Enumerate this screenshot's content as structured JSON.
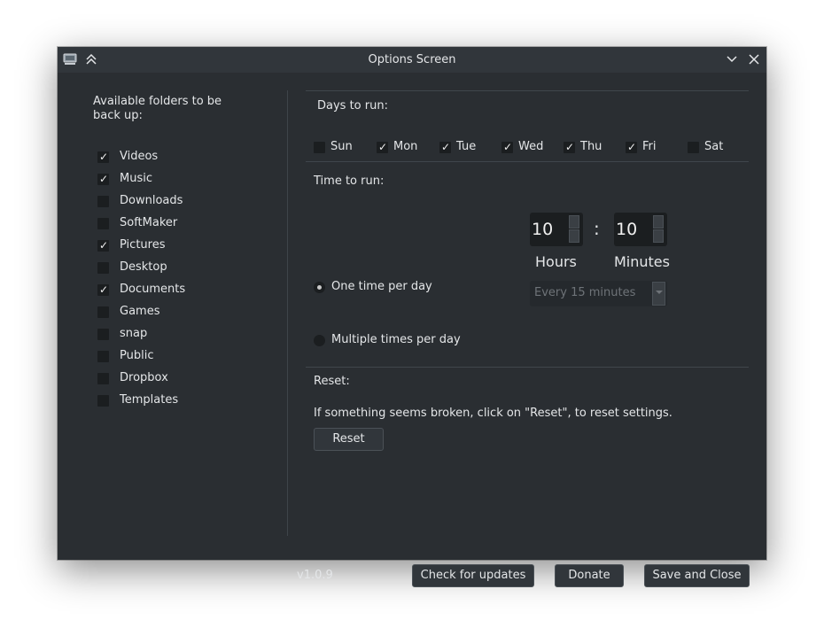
{
  "window": {
    "title": "Options Screen"
  },
  "folders": {
    "heading": "Available folders to be back up:",
    "items": [
      {
        "label": "Videos",
        "checked": true
      },
      {
        "label": "Music",
        "checked": true
      },
      {
        "label": "Downloads",
        "checked": false
      },
      {
        "label": "SoftMaker",
        "checked": false
      },
      {
        "label": "Pictures",
        "checked": true
      },
      {
        "label": "Desktop",
        "checked": false
      },
      {
        "label": "Documents",
        "checked": true
      },
      {
        "label": "Games",
        "checked": false
      },
      {
        "label": "snap",
        "checked": false
      },
      {
        "label": "Public",
        "checked": false
      },
      {
        "label": "Dropbox",
        "checked": false
      },
      {
        "label": "Templates",
        "checked": false
      }
    ]
  },
  "days": {
    "heading": "Days to run:",
    "items": [
      {
        "label": "Sun",
        "checked": false
      },
      {
        "label": "Mon",
        "checked": true
      },
      {
        "label": "Tue",
        "checked": true
      },
      {
        "label": "Wed",
        "checked": true
      },
      {
        "label": "Thu",
        "checked": true
      },
      {
        "label": "Fri",
        "checked": true
      },
      {
        "label": "Sat",
        "checked": false
      }
    ]
  },
  "time": {
    "heading": "Time to run:",
    "one_time_label": "One time per day",
    "multiple_label": "Multiple times per day",
    "hours_value": "10",
    "minutes_value": "10",
    "separator": ":",
    "hours_label": "Hours",
    "minutes_label": "Minutes",
    "interval_value": "Every 15 minutes",
    "selected_mode": "one_time"
  },
  "reset": {
    "heading": "Reset:",
    "description": "If something seems broken, click on \"Reset\", to reset settings.",
    "button_label": "Reset"
  },
  "footer": {
    "version": "v1.0.9",
    "check_updates_label": "Check for updates",
    "donate_label": "Donate",
    "save_close_label": "Save and Close"
  },
  "check_glyph": "✓"
}
